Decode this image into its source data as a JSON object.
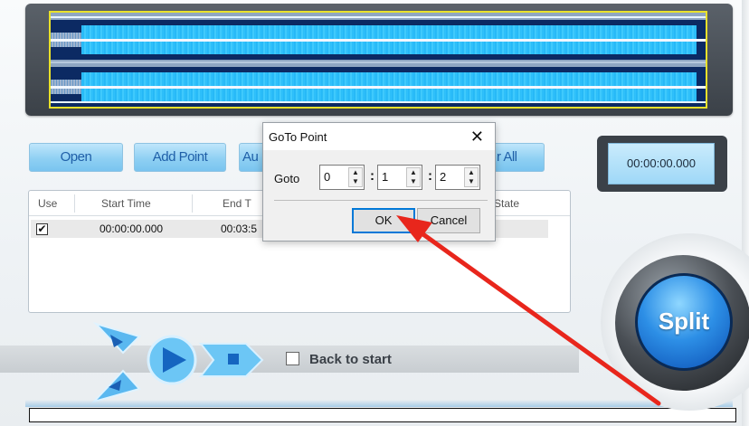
{
  "toolbar": {
    "open_label": "Open",
    "add_point_label": "Add Point",
    "auto_label_partial": "Au",
    "clear_all_label_partial": "r All"
  },
  "time_display": "00:00:00.000",
  "table": {
    "headers": [
      "Use",
      "Start  Time",
      "End  T",
      "State"
    ],
    "rows": [
      {
        "use": true,
        "start": "00:00:00.000",
        "end": "00:03:5"
      }
    ]
  },
  "player": {
    "back_to_start_label": "Back to start",
    "back_to_start_checked": false
  },
  "split_label": "Split",
  "dialog": {
    "title": "GoTo Point",
    "close_glyph": "✕",
    "goto_label": "Goto",
    "hours": "0",
    "minutes": "1",
    "seconds": "2",
    "separator": ":",
    "ok_label": "OK",
    "cancel_label": "Cancel"
  },
  "colors": {
    "annotation_arrow": "#e8261c",
    "button_text": "#1f5fa8",
    "wave_fill": "#22b8f6"
  }
}
